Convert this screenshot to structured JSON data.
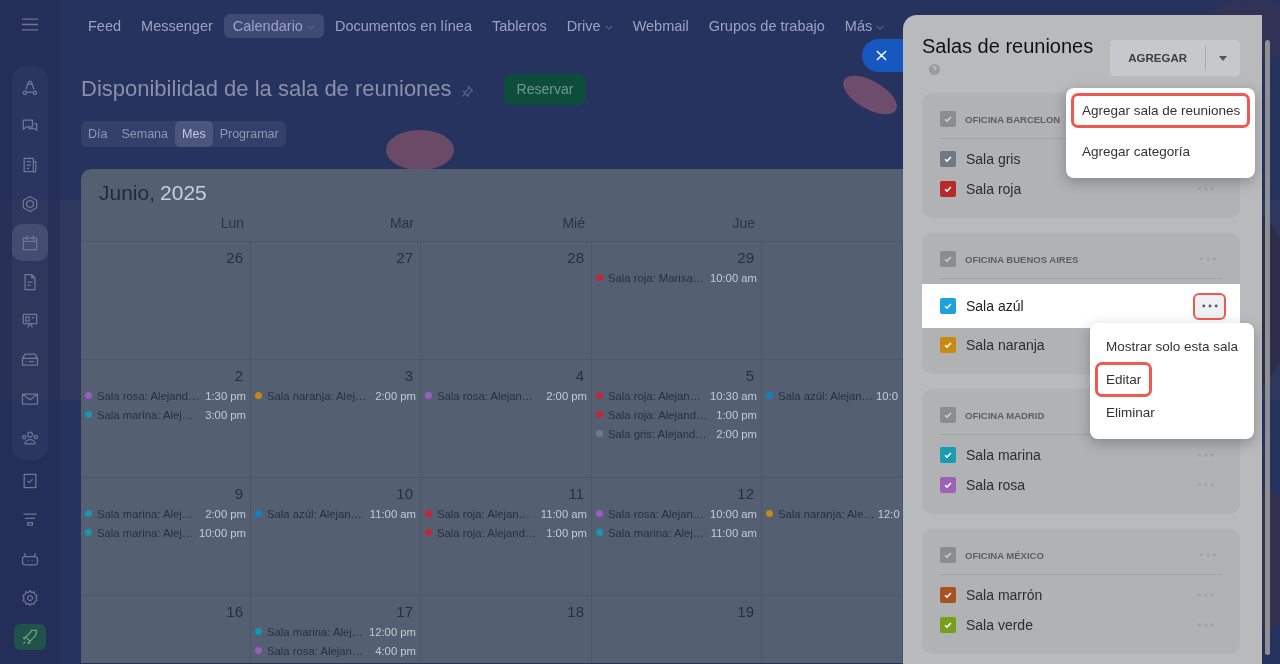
{
  "sidebar": {
    "items": [
      {
        "kind": "share",
        "selected": false
      },
      {
        "kind": "chat",
        "selected": false
      },
      {
        "kind": "news",
        "selected": false
      },
      {
        "kind": "hexagon",
        "selected": false
      },
      {
        "kind": "calendar",
        "selected": true
      },
      {
        "kind": "document",
        "selected": false
      },
      {
        "kind": "board",
        "selected": false
      },
      {
        "kind": "drive",
        "selected": false
      },
      {
        "kind": "mail",
        "selected": false
      },
      {
        "kind": "people",
        "selected": false
      },
      {
        "kind": "task",
        "selected": false
      },
      {
        "kind": "funnel",
        "selected": false
      },
      {
        "kind": "robot",
        "selected": false
      },
      {
        "kind": "gear",
        "selected": false
      },
      {
        "kind": "rocket",
        "selected": false
      }
    ]
  },
  "nav": {
    "items": [
      {
        "label": "Feed",
        "selected": false,
        "dropdown": false
      },
      {
        "label": "Messenger",
        "selected": false,
        "dropdown": false
      },
      {
        "label": "Calendario",
        "selected": true,
        "dropdown": true
      },
      {
        "label": "Documentos en línea",
        "selected": false,
        "dropdown": false
      },
      {
        "label": "Tableros",
        "selected": false,
        "dropdown": false
      },
      {
        "label": "Drive",
        "selected": false,
        "dropdown": true
      },
      {
        "label": "Webmail",
        "selected": false,
        "dropdown": false
      },
      {
        "label": "Grupos de trabajo",
        "selected": false,
        "dropdown": false
      },
      {
        "label": "Más",
        "selected": false,
        "dropdown": true
      }
    ]
  },
  "page": {
    "title": "Disponibilidad de la sala de reuniones",
    "action": "Reservar",
    "views": [
      {
        "label": "Día",
        "selected": false
      },
      {
        "label": "Semana",
        "selected": false
      },
      {
        "label": "Mes",
        "selected": true
      },
      {
        "label": "Programar",
        "selected": false
      }
    ]
  },
  "calendar": {
    "month": "Junio,",
    "year": "2025",
    "weekdays": [
      "Lun",
      "Mar",
      "Mié",
      "Jue"
    ],
    "weeks": [
      {
        "days": [
          {
            "date": "26"
          },
          {
            "date": "27"
          },
          {
            "date": "28"
          },
          {
            "date": "29",
            "events": [
              {
                "title": "Sala roja: Marisa…",
                "time": "10:00 am",
                "color": "#c0283a"
              }
            ]
          }
        ]
      },
      {
        "days": [
          {
            "date": "2",
            "events": [
              {
                "title": "Sala rosa: Alejand…",
                "time": "1:30 pm",
                "color": "#9a5cc0"
              },
              {
                "title": "Sala marina: Alej…",
                "time": "3:00 pm",
                "color": "#1597b0"
              }
            ]
          },
          {
            "date": "3",
            "events": [
              {
                "title": "Sala naranja: Alej…",
                "time": "2:00 pm",
                "color": "#c08a1a"
              }
            ]
          },
          {
            "date": "4",
            "events": [
              {
                "title": "Sala rosa: Alejan…",
                "time": "2:00 pm",
                "color": "#9a5cc0"
              }
            ]
          },
          {
            "date": "5",
            "events": [
              {
                "title": "Sala roja: Alejan…",
                "time": "10:30 am",
                "color": "#c0283a"
              },
              {
                "title": "Sala roja: Alejand…",
                "time": "1:00 pm",
                "color": "#c0283a"
              },
              {
                "title": "Sala gris: Alejand…",
                "time": "2:00 pm",
                "color": "#6b7a90"
              }
            ]
          },
          {
            "events": [
              {
                "title": "Sala azúl: Alejan…",
                "time": "10:0",
                "color": "#1580c0"
              }
            ]
          }
        ]
      },
      {
        "days": [
          {
            "date": "9",
            "events": [
              {
                "title": "Sala marina: Alej…",
                "time": "2:00 pm",
                "color": "#1597b0"
              },
              {
                "title": "Sala marina: Alej…",
                "time": "10:00 pm",
                "color": "#1597b0"
              }
            ]
          },
          {
            "date": "10",
            "events": [
              {
                "title": "Sala azúl: Alejan…",
                "time": "11:00 am",
                "color": "#1580c0"
              }
            ]
          },
          {
            "date": "11",
            "events": [
              {
                "title": "Sala roja: Alejan…",
                "time": "11:00 am",
                "color": "#c0283a"
              },
              {
                "title": "Sala roja: Alejand…",
                "time": "1:00 pm",
                "color": "#c0283a"
              }
            ]
          },
          {
            "date": "12",
            "events": [
              {
                "title": "Sala rosa: Alejan…",
                "time": "10:00 am",
                "color": "#9a5cc0"
              },
              {
                "title": "Sala marina: Alej…",
                "time": "11:00 am",
                "color": "#1597b0"
              }
            ]
          },
          {
            "events": [
              {
                "title": "Sala naranja: Ale…",
                "time": "12:0",
                "color": "#c08a1a"
              }
            ]
          }
        ]
      },
      {
        "days": [
          {
            "date": "16"
          },
          {
            "date": "17",
            "events": [
              {
                "title": "Sala marina: Alej…",
                "time": "12:00 pm",
                "color": "#1597b0"
              },
              {
                "title": "Sala rosa: Alejan…",
                "time": "4:00 pm",
                "color": "#9a5cc0"
              }
            ]
          },
          {
            "date": "18"
          },
          {
            "date": "19"
          }
        ]
      }
    ]
  },
  "panel": {
    "title": "Salas de reuniones",
    "add_button": "AGREGAR",
    "groups": [
      {
        "name": "OFICINA BARCELON",
        "checked": true,
        "rooms": [
          {
            "name": "Sala gris",
            "color": "#6f7885",
            "checked": true,
            "highlighted": false,
            "annotated": false
          },
          {
            "name": "Sala roja",
            "color": "#b82a2a",
            "checked": true,
            "highlighted": false,
            "annotated": false
          }
        ]
      },
      {
        "name": "OFICINA BUENOS AIRES",
        "checked": true,
        "rooms": [
          {
            "name": "Sala azúl",
            "color": "#1ea2de",
            "checked": true,
            "highlighted": true,
            "annotated": true
          },
          {
            "name": "Sala naranja",
            "color": "#c88a10",
            "checked": true,
            "highlighted": false,
            "annotated": false
          }
        ]
      },
      {
        "name": "OFICINA MADRID",
        "checked": true,
        "rooms": [
          {
            "name": "Sala marina",
            "color": "#1a9bb0",
            "checked": true,
            "highlighted": false,
            "annotated": false
          },
          {
            "name": "Sala rosa",
            "color": "#9c62b8",
            "checked": true,
            "highlighted": false,
            "annotated": false
          }
        ]
      },
      {
        "name": "OFICINA MÉXICO",
        "checked": true,
        "rooms": [
          {
            "name": "Sala marrón",
            "color": "#a8521f",
            "checked": true,
            "highlighted": false,
            "annotated": false
          },
          {
            "name": "Sala verde",
            "color": "#76a01a",
            "checked": true,
            "highlighted": false,
            "annotated": false
          }
        ]
      }
    ]
  },
  "add_menu": {
    "items": [
      {
        "label": "Agregar sala de reuniones",
        "annotated": true
      },
      {
        "label": "Agregar categoría",
        "annotated": false
      }
    ]
  },
  "room_menu": {
    "items": [
      {
        "label": "Mostrar solo esta sala",
        "annotated": false
      },
      {
        "label": "Editar",
        "annotated": true
      },
      {
        "label": "Eliminar",
        "annotated": false
      }
    ]
  }
}
